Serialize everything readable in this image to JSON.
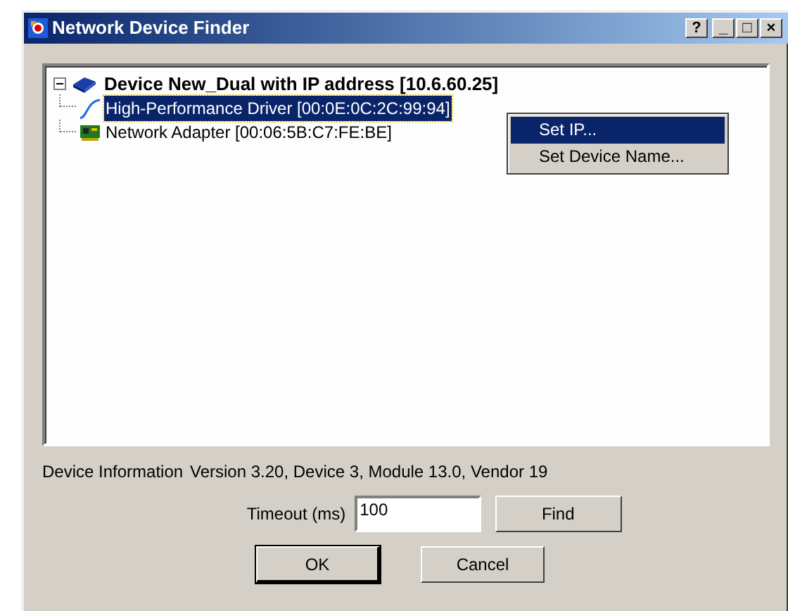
{
  "window": {
    "title": "Network Device Finder",
    "buttons": [
      "?",
      "_",
      "□",
      "×"
    ]
  },
  "tree": [
    {
      "label": "Device New_Dual with IP address [10.6.60.25]",
      "kind": "device",
      "expanded": true,
      "selected": false,
      "children": [
        {
          "label": "High-Performance Driver [00:0E:0C:2C:99:94]",
          "kind": "driver",
          "selected": true
        },
        {
          "label": "Network Adapter [00:06:5B:C7:FE:BE]",
          "kind": "adapter",
          "selected": false
        }
      ]
    }
  ],
  "context_menu": [
    {
      "label": "Set IP...",
      "selected": true
    },
    {
      "label": "Set Device Name...",
      "selected": false
    }
  ],
  "device_information": {
    "label": "Device Information",
    "value": "Version 3.20, Device 3, Module 13.0, Vendor 19"
  },
  "timeout": {
    "label": "Timeout (ms)",
    "value": "100"
  },
  "find_button": "Find",
  "buttons": [
    "OK",
    "Cancel"
  ]
}
